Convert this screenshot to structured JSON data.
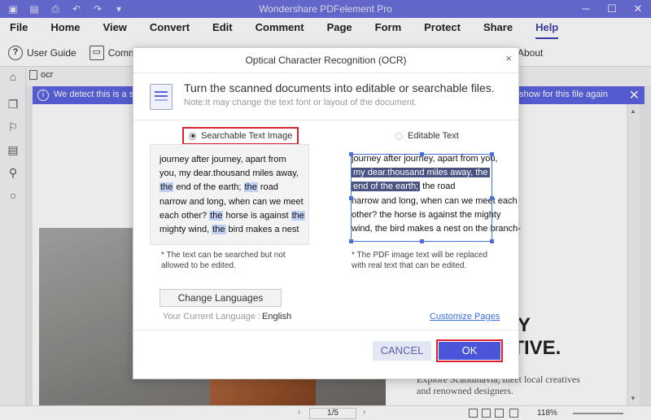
{
  "window": {
    "title": "Wondershare PDFelement Pro",
    "controls": {
      "minimize": "─",
      "maximize": "☐",
      "close": "✕"
    }
  },
  "quick_access": [
    "logo",
    "save",
    "print",
    "undo",
    "redo",
    "customize"
  ],
  "menu": {
    "items": [
      "File",
      "Home",
      "View",
      "Convert",
      "Edit",
      "Comment",
      "Page",
      "Form",
      "Protect",
      "Share",
      "Help"
    ],
    "active": "Help"
  },
  "toolbar": {
    "user_guide": "User Guide",
    "community": "Communi",
    "about": "About"
  },
  "tab": {
    "label": "ocr"
  },
  "notification": {
    "message_start": "We detect this is a scan",
    "message_end": "t show for this file again"
  },
  "document": {
    "heading_line1": "Y",
    "heading_line2": "CTIVE.",
    "body_line1": "Explore Scandinavia, meet local creatives",
    "body_line2": "and renowned designers."
  },
  "status": {
    "page": "1",
    "page_total": "/5",
    "zoom": "118%"
  },
  "dialog": {
    "title": "Optical Character Recognition (OCR)",
    "close": "×",
    "header_text": "Turn the scanned documents into editable or searchable files.",
    "header_note": "Note:It may change the text font or layout of the document.",
    "option_searchable": "Searchable Text Image",
    "option_editable": "Editable Text",
    "selected_option": "searchable",
    "left_preview": {
      "l1": "journey after journey, apart from",
      "l2": "you, my dear.thousand miles away,",
      "l3a": "the",
      "l3b": " end of the earth; ",
      "l3c": "the",
      "l3d": " road",
      "l4": "narrow and long, when can we meet",
      "l5a": "each other? ",
      "l5b": "the",
      "l5c": " horse is against ",
      "l5d": "the",
      "l6a": "mighty wind, ",
      "l6b": "the",
      "l6c": " bird makes a nest"
    },
    "right_preview": {
      "l1": "journey after journey, apart from you,",
      "l2": "my dear.thousand miles away, the",
      "l3": "end of the earth;",
      "l3b": " the road",
      "l4": "narrow and long, when can we meet each",
      "l5": "other? the horse is against the mighty",
      "l6": "wind, the bird makes a nest on the branch-"
    },
    "left_caption_1": "* The text can be searched but not",
    "left_caption_2": "allowed to be edited.",
    "right_caption_1": "* The PDF image text will be replaced",
    "right_caption_2": "with real text that can be edited.",
    "change_languages": "Change Languages",
    "current_language_label": "Your Current Language :",
    "current_language": "English",
    "customize_pages": "Customize Pages",
    "cancel": "CANCEL",
    "ok": "OK"
  },
  "colors": {
    "titlebar": "#6b6fd9",
    "accent": "#4a55d9",
    "highlight_border": "#d9232e",
    "link": "#3d6ee0"
  }
}
